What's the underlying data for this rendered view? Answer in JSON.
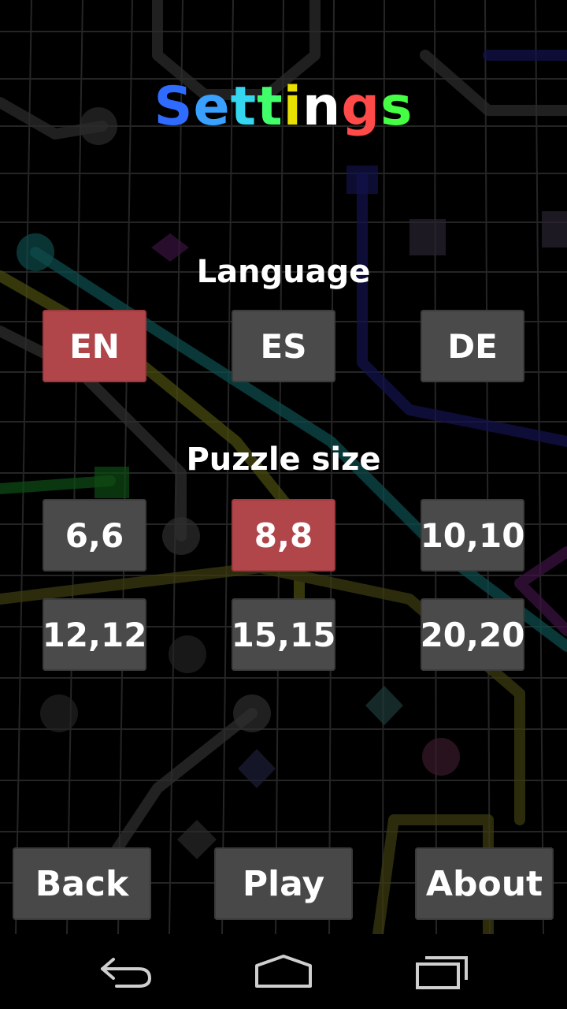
{
  "title": {
    "letters": [
      "S",
      "e",
      "t",
      "t",
      "i",
      "n",
      "g",
      "s"
    ],
    "colors": [
      "#2f6bff",
      "#3aa0ff",
      "#34d6f0",
      "#40ff6a",
      "#e8e000",
      "#ffffff",
      "#ff4a4a",
      "#44ff44"
    ]
  },
  "language": {
    "label": "Language",
    "options": [
      "EN",
      "ES",
      "DE"
    ],
    "selected": "EN"
  },
  "puzzle_size": {
    "label": "Puzzle size",
    "options": [
      "6,6",
      "8,8",
      "10,10",
      "12,12",
      "15,15",
      "20,20"
    ],
    "selected": "8,8"
  },
  "actions": {
    "back": "Back",
    "play": "Play",
    "about": "About"
  },
  "colors": {
    "selected": "#b0454a",
    "button": "#4a4a4a"
  },
  "system_nav": {
    "back_icon": "back-arrow-icon",
    "home_icon": "home-icon",
    "recents_icon": "recents-icon"
  }
}
